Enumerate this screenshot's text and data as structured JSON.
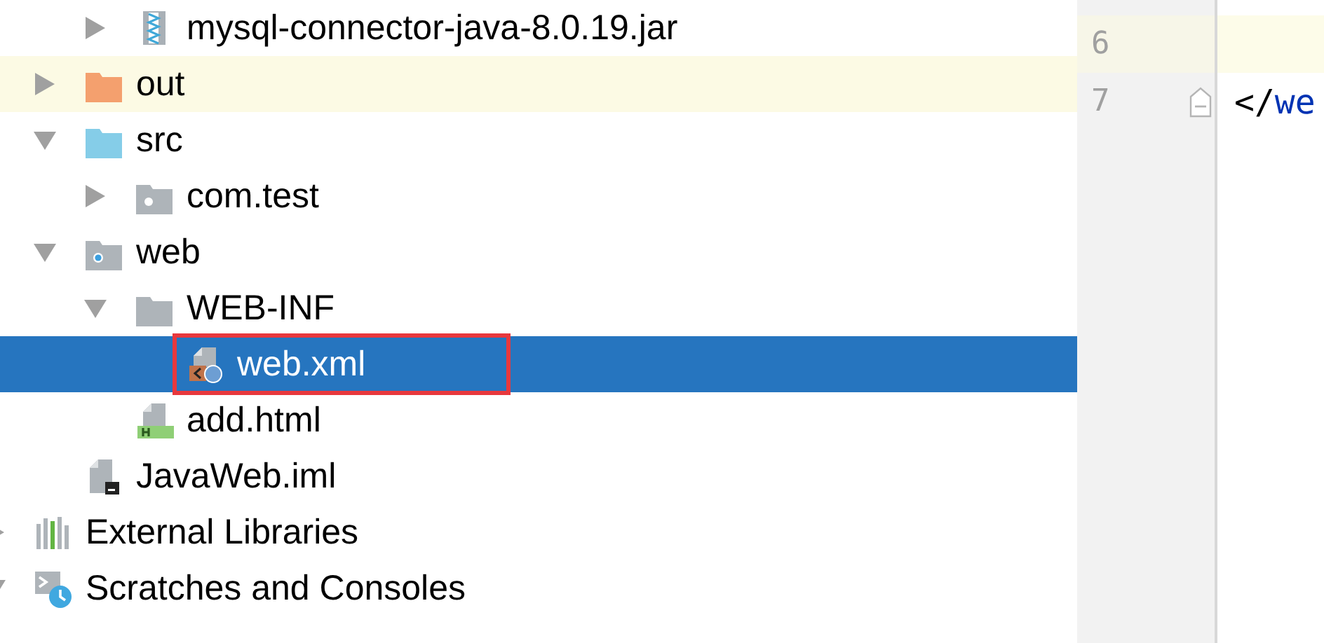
{
  "project_tree": {
    "items": [
      {
        "children": [
          {
            "children": [
              {
                "label": "mysql-connector-java-8.0.19.jar",
                "kind": "jar",
                "expanded": false,
                "selected": false,
                "hovered": false
              }
            ]
          },
          {
            "label": "out",
            "kind": "excluded-folder",
            "expanded": false,
            "selected": false,
            "hovered": true
          },
          {
            "label": "src",
            "kind": "source-folder",
            "expanded": true,
            "selected": false,
            "hovered": false,
            "children": [
              {
                "label": "com.test",
                "kind": "package",
                "expanded": false,
                "selected": false,
                "hovered": false
              }
            ]
          },
          {
            "label": "web",
            "kind": "web-folder",
            "expanded": true,
            "selected": false,
            "hovered": false,
            "children": [
              {
                "label": "WEB-INF",
                "kind": "folder",
                "expanded": true,
                "selected": false,
                "hovered": false,
                "children": [
                  {
                    "label": "web.xml",
                    "kind": "xml",
                    "selected": true,
                    "hovered": false,
                    "annotated": true
                  }
                ]
              },
              {
                "label": "add.html",
                "kind": "html",
                "selected": false,
                "hovered": false
              }
            ]
          },
          {
            "label": "JavaWeb.iml",
            "kind": "iml",
            "selected": false,
            "hovered": false
          }
        ]
      },
      {
        "label": "External Libraries",
        "kind": "libraries",
        "expanded": false,
        "selected": false,
        "hovered": false
      },
      {
        "label": "Scratches and Consoles",
        "kind": "scratches",
        "expanded": true,
        "selected": false,
        "hovered": false
      }
    ]
  },
  "editor": {
    "lines": [
      {
        "number": "6",
        "current": true
      },
      {
        "number": "7",
        "current": false,
        "fold": true,
        "tokens": [
          {
            "text": "</",
            "kind": "punct"
          },
          {
            "text": "we",
            "kind": "tag"
          }
        ]
      }
    ]
  }
}
